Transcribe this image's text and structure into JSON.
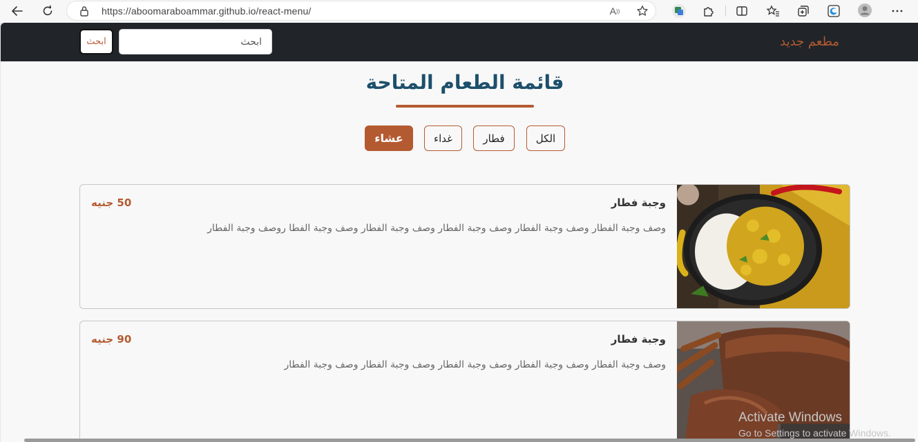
{
  "browser": {
    "url_host": "https://aboomaraboammar.github.io",
    "url_path": "/react-menu/",
    "read_aloud_glyph": "A",
    "icons": [
      "back-icon",
      "refresh-icon",
      "lock-icon",
      "read-aloud-icon",
      "favorite-star-icon",
      "translate-icon",
      "extensions-icon",
      "split-screen-icon",
      "favorites-icon",
      "collections-icon",
      "edge-icon",
      "profile-icon",
      "more-icon"
    ]
  },
  "navbar": {
    "brand": "مطعم جديد",
    "search_placeholder": "ابحث",
    "search_button": "ابحث"
  },
  "main": {
    "title": "قائمة الطعام المتاحة",
    "filters": [
      {
        "label": "الكل",
        "active": false
      },
      {
        "label": "فطار",
        "active": false
      },
      {
        "label": "غداء",
        "active": false
      },
      {
        "label": "عشاء",
        "active": true
      }
    ],
    "items": [
      {
        "name": "وجبة فطار",
        "price": "50 جنيه",
        "description": "وصف وجبة الفطار وصف وجبة الفطار وصف وجبة الفطار وصف وجبة الفطار وصف وجبة الفطا روصف وجبة الفطار",
        "image": "rice-curry-image"
      },
      {
        "name": "وجبة فطار",
        "price": "90 جنيه",
        "description": "وصف وجبة الفطار وصف وجبة الفطار وصف وجبة الفطار وصف وجبة الفطار وصف وجبة الفطار",
        "image": "chocolate-bread-image"
      }
    ]
  },
  "watermark": {
    "line1": "Activate Windows",
    "line2": "Go to Settings to activate Windows."
  },
  "colors": {
    "accent": "#b45a31",
    "title": "#1d4f6b",
    "navbar": "#212529"
  }
}
